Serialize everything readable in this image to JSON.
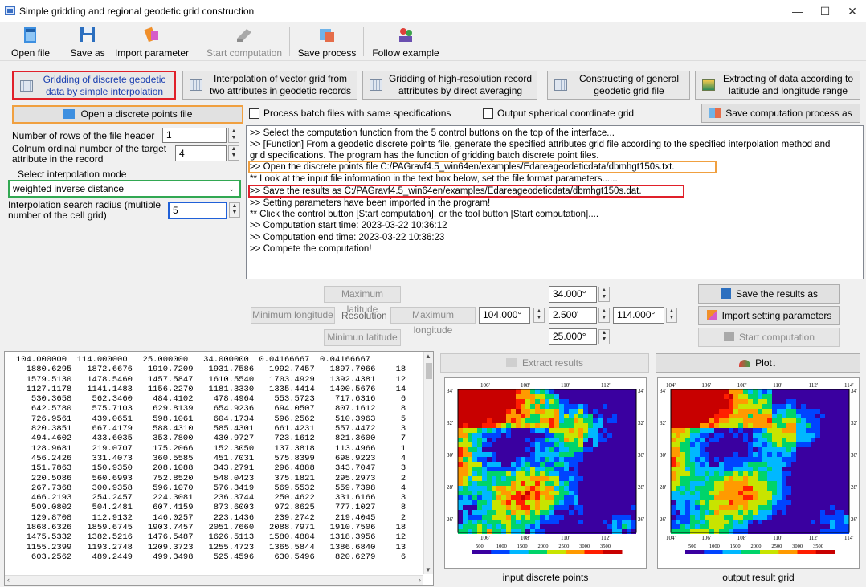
{
  "window": {
    "title": "Simple gridding and regional geodetic grid construction",
    "min_glyph": "—",
    "max_glyph": "☐",
    "close_glyph": "✕"
  },
  "toolbar": {
    "open_file": "Open file",
    "save_as": "Save as",
    "import_parameter": "Import parameter",
    "start_computation": "Start computation",
    "save_process": "Save process",
    "follow_example": "Follow example"
  },
  "functions": {
    "f1_line1": "Gridding of discrete geodetic",
    "f1_line2": "data by simple interpolation",
    "f2_line1": "Interpolation of vector grid from",
    "f2_line2": "two attributes in geodetic records",
    "f3_line1": "Gridding of high-resolution record",
    "f3_line2": "attributes by direct averaging",
    "f4_line1": "Constructing of general",
    "f4_line2": "geodetic grid file",
    "f5_line1": "Extracting of data according to",
    "f5_line2": "latitude and longitude range"
  },
  "left_panel": {
    "open_points_button": "Open a discrete points file",
    "header_rows_label": "Number of rows of the file header",
    "header_rows_value": "1",
    "ordinal_label_1": "Colnum ordinal number of the target",
    "ordinal_label_2": "attribute in the record",
    "ordinal_value": "4",
    "interp_mode_label": "Select interpolation mode",
    "interp_mode_value": "weighted inverse distance",
    "radius_label_1": "Interpolation search radius (multiple",
    "radius_label_2": "number of the cell grid)",
    "radius_value": "5"
  },
  "options": {
    "batch_label": "Process batch files with same specifications",
    "spherical_label": "Output spherical coordinate grid",
    "save_process_button": "Save computation process as"
  },
  "log": [
    ">> Select the computation function from the 5 control buttons on the top of the interface...",
    ">> [Function] From a geodetic discrete points file, generate the specified attributes grid file according to the specified interpolation method and",
    "grid specifications. The program has the function of gridding batch discrete point files.",
    ">> Open the discrete points file C:/PAGravf4.5_win64en/examples/Edareageodeticdata/dbmhgt150s.txt.",
    "   ** Look at the input file information in the text box below, set the file format parameters......",
    ">> Save the results as C:/PAGravf4.5_win64en/examples/Edareageodeticdata/dbmhgt150s.dat.",
    ">> Setting parameters have been imported in the program!",
    "   ** Click the control button [Start computation], or the tool button [Start computation]....",
    ">> Computation start time:  2023-03-22 10:36:12",
    ">> Computation end time:  2023-03-22 10:36:23",
    ">> Compete the computation!"
  ],
  "grid_spec": {
    "max_lat_label": "Maximum latitude",
    "max_lat_value": "34.000°",
    "min_lon_label": "Minimum longitude",
    "resolution_label": "Resolution",
    "max_lon_label": "Maximum longitude",
    "min_lon_value": "104.000°",
    "resolution_value": "2.500'",
    "max_lon_value": "114.000°",
    "min_lat_label": "Minimun latitude",
    "min_lat_value": "25.000°",
    "save_results_button": "Save the results as",
    "import_settings_button": "Import setting parameters",
    "start_button": "Start computation"
  },
  "data_text": [
    "104.000000  114.000000   25.000000   34.000000  0.04166667  0.04166667",
    "  1880.6295   1872.6676   1910.7209   1931.7586   1992.7457   1897.7066    18",
    "  1579.5130   1478.5460   1457.5847   1610.5540   1703.4929   1392.4381    12",
    "  1127.1178   1141.1483   1156.2270   1181.3330   1335.4414   1400.5676    14",
    "   530.3658    562.3460    484.4102    478.4964    553.5723    717.6316     6",
    "   642.5780    575.7103    629.8139    654.9236    694.0507    807.1612     8",
    "   726.9561    439.0651    598.1061    604.1734    596.2562    510.3963     5",
    "   820.3851    667.4179    588.4310    585.4301    661.4231    557.4472     3",
    "   494.4602    433.6035    353.7800    430.9727    723.1612    821.3600     7",
    "   128.9681    219.0707    175.2066    152.3050    137.3818    113.4966     1",
    "   456.2426    331.4073    360.5585    451.7031    575.8399    698.9223     4",
    "   151.7863    150.9350    208.1088    343.2791    296.4888    343.7047     3",
    "   220.5086    560.6993    752.8520    548.0423    375.1821    295.2973     2",
    "   267.7368    300.9358    596.1070    576.3419    569.5532    559.7398     4",
    "   466.2193    254.2457    224.3081    236.3744    250.4622    331.6166     3",
    "   509.0802    504.2481    607.4159    873.6003    972.8625    777.1027     8",
    "   129.8708    112.9132    146.0257    223.1436    239.2742    219.4045     2",
    "  1868.6326   1859.6745   1903.7457   2051.7660   2088.7971   1910.7506    18",
    "  1475.5332   1382.5216   1476.5487   1626.5113   1580.4884   1318.3956    12",
    "  1155.2399   1193.2748   1209.3723   1255.4723   1365.5844   1386.6840    13",
    "   603.2562    489.2449    499.3498    525.4596    630.5496    820.6279     6"
  ],
  "result_panel": {
    "extract_button": "Extract results",
    "plot_button": "Plot↓",
    "input_caption": "input discrete points",
    "output_caption": "output result grid"
  },
  "map": {
    "lon_ticks": [
      "106'",
      "108'",
      "110'",
      "112'"
    ],
    "lon_ticks_right": [
      "104'",
      "106'",
      "108'",
      "110'",
      "112'",
      "114'"
    ],
    "lat_ticks": [
      "34'",
      "32'",
      "30'",
      "28'",
      "26'"
    ],
    "colorbar_ticks": [
      "500",
      "1000",
      "1500",
      "2000",
      "2500",
      "3000",
      "3500"
    ],
    "colors": [
      "#3a00a0",
      "#0044ff",
      "#00b8ff",
      "#00d46a",
      "#c8e400",
      "#ff9a00",
      "#ff1e00",
      "#c80000"
    ]
  },
  "colors": {
    "red_highlight": "#e0202a",
    "orange_highlight": "#f0a040",
    "green_highlight": "#32a852",
    "blue_highlight": "#2060d8"
  }
}
